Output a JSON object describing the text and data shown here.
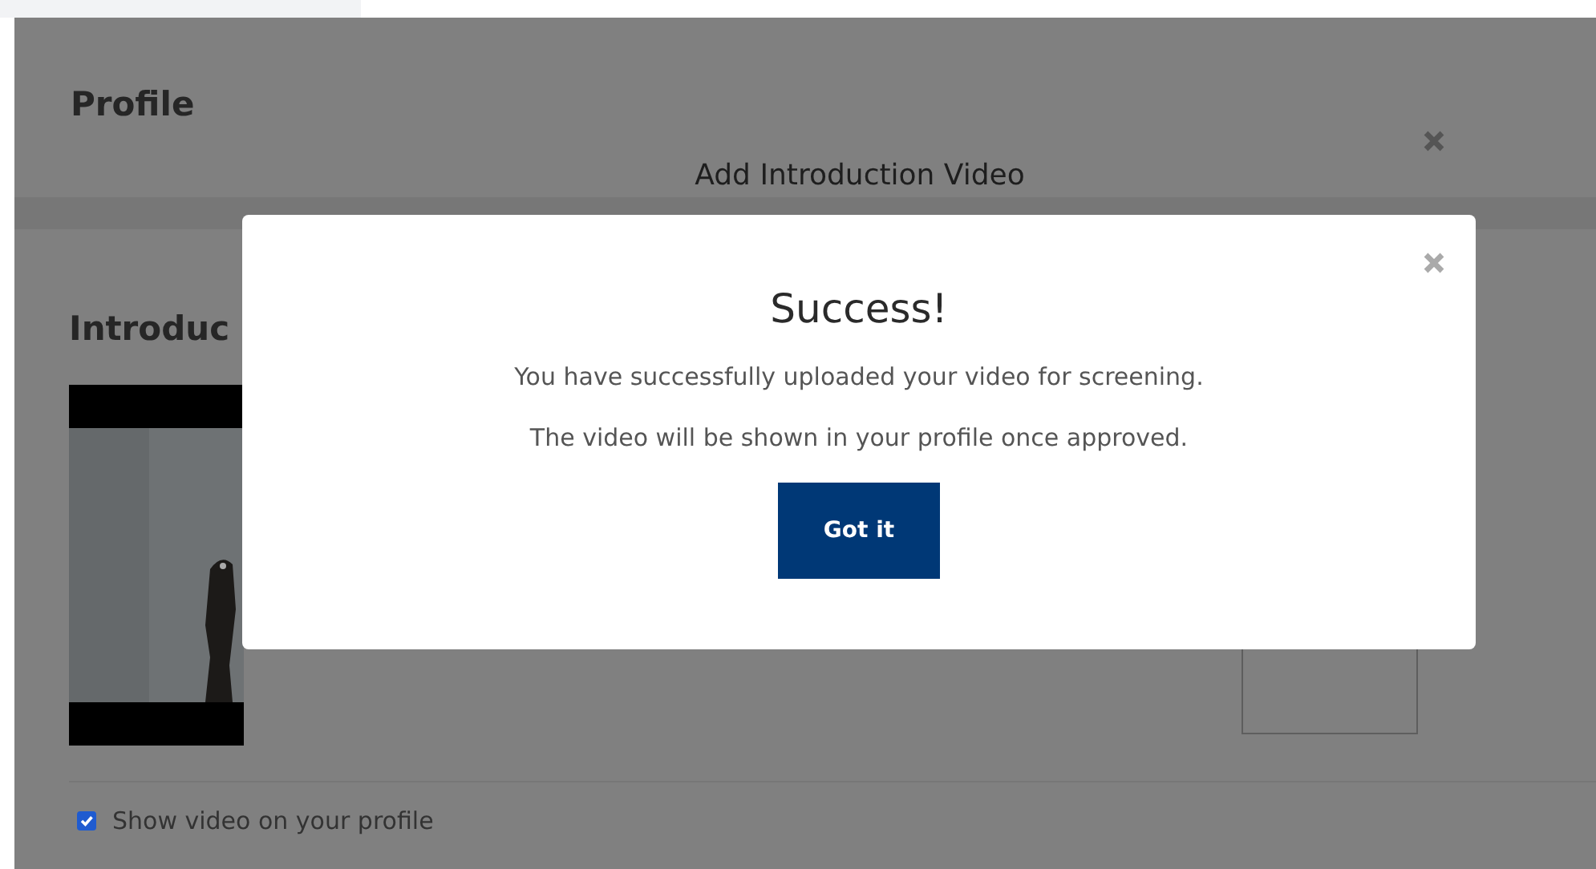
{
  "page": {
    "title": "Profile",
    "section_heading": "Introduc",
    "show_video": {
      "label": "Show video on your profile",
      "checked": true
    }
  },
  "background_dialog": {
    "title": "Add Introduction Video"
  },
  "modal": {
    "title": "Success!",
    "messages": [
      "You have successfully uploaded your video for screening.",
      "The video will be shown in your profile once approved."
    ],
    "button": "Got it"
  }
}
